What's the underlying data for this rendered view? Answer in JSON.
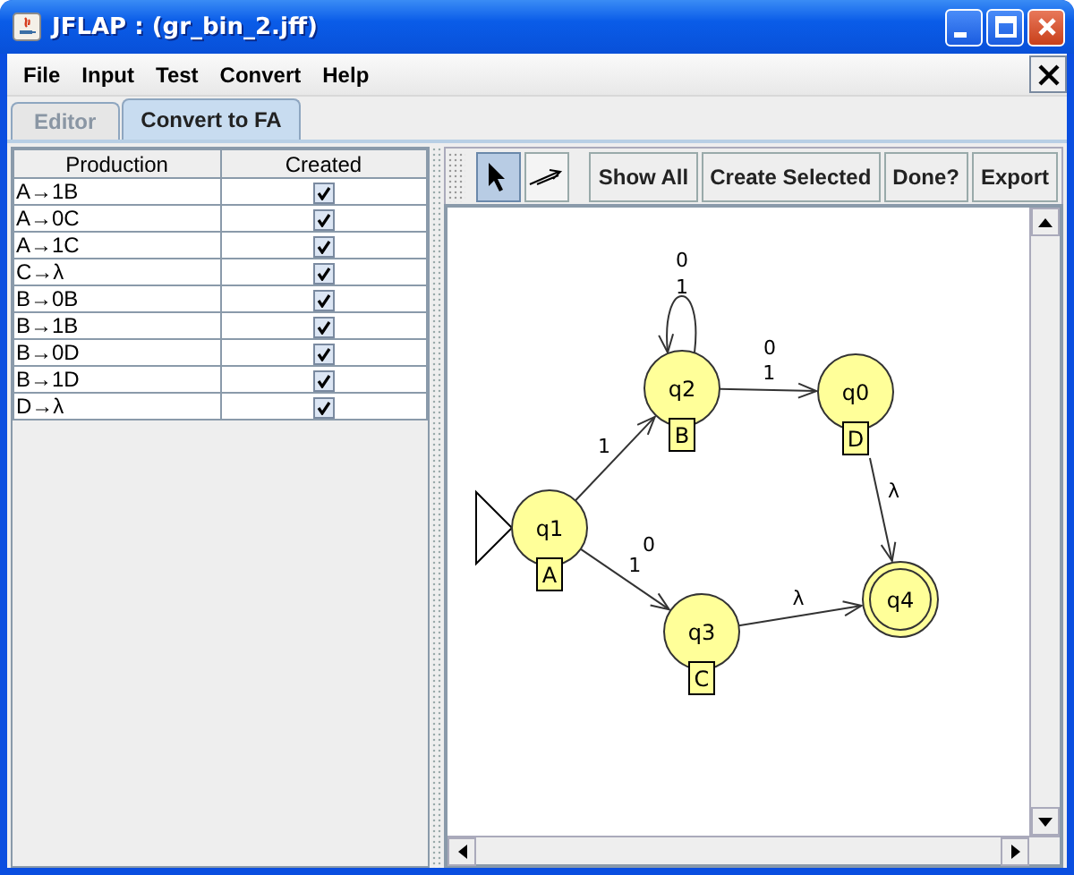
{
  "window": {
    "title": "JFLAP : (gr_bin_2.jff)"
  },
  "menu": [
    "File",
    "Input",
    "Test",
    "Convert",
    "Help"
  ],
  "tabs": [
    {
      "label": "Editor",
      "selected": false
    },
    {
      "label": "Convert to FA",
      "selected": true
    }
  ],
  "table": {
    "columns": [
      "Production",
      "Created"
    ],
    "rows": [
      {
        "production": "A→1B",
        "created": true
      },
      {
        "production": "A→0C",
        "created": true
      },
      {
        "production": "A→1C",
        "created": true
      },
      {
        "production": "C→λ",
        "created": true
      },
      {
        "production": "B→0B",
        "created": true
      },
      {
        "production": "B→1B",
        "created": true
      },
      {
        "production": "B→0D",
        "created": true
      },
      {
        "production": "B→1D",
        "created": true
      },
      {
        "production": "D→λ",
        "created": true
      }
    ]
  },
  "tools": [
    {
      "kind": "select",
      "selected": true
    },
    {
      "kind": "transition",
      "selected": false
    }
  ],
  "buttons": [
    "Show All",
    "Create Selected",
    "Done?",
    "Export"
  ],
  "automaton": {
    "states": [
      {
        "name": "q2",
        "label": "B",
        "initial": false,
        "final": false
      },
      {
        "name": "q0",
        "label": "D",
        "initial": false,
        "final": false
      },
      {
        "name": "q1",
        "label": "A",
        "initial": true,
        "final": false
      },
      {
        "name": "q3",
        "label": "C",
        "initial": false,
        "final": false
      },
      {
        "name": "q4",
        "initial": false,
        "final": true
      }
    ],
    "transitions": [
      {
        "labels": [
          "0",
          "1"
        ]
      },
      {
        "labels": [
          "0",
          "1"
        ]
      },
      {
        "labels": [
          "1"
        ]
      },
      {
        "labels": [
          "0",
          "1"
        ]
      },
      {
        "labels": [
          "λ"
        ]
      },
      {
        "labels": [
          "λ"
        ]
      }
    ]
  }
}
